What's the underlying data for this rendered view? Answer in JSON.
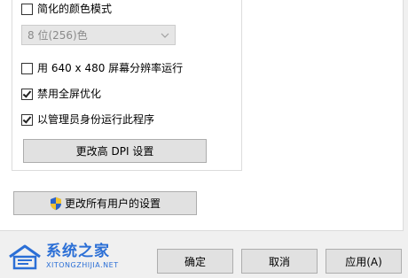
{
  "settings": {
    "reduced_color": {
      "label": "简化的颜色模式",
      "checked": false
    },
    "color_mode_select": {
      "value": "8 位(256)色",
      "disabled": true
    },
    "run_640x480": {
      "label": "用 640 x 480 屏幕分辨率运行",
      "checked": false
    },
    "disable_fullscreen_opt": {
      "label": "禁用全屏优化",
      "checked": true
    },
    "run_as_admin": {
      "label": "以管理员身份运行此程序",
      "checked": true
    },
    "change_dpi_button": "更改高 DPI 设置"
  },
  "change_all_users_button": "更改所有用户的设置",
  "footer": {
    "ok_label": "确定",
    "cancel_label": "取消",
    "apply_label": "应用(A)"
  },
  "watermark": {
    "cn_text": "系统之家",
    "en_text": "XITONGZHIJIA.NET"
  },
  "colors": {
    "panel_bg": "#ffffff",
    "dialog_bg": "#f0f0f0",
    "button_bg": "#e1e1e1",
    "button_border": "#adadad",
    "watermark_blue": "#2b6fd6"
  }
}
